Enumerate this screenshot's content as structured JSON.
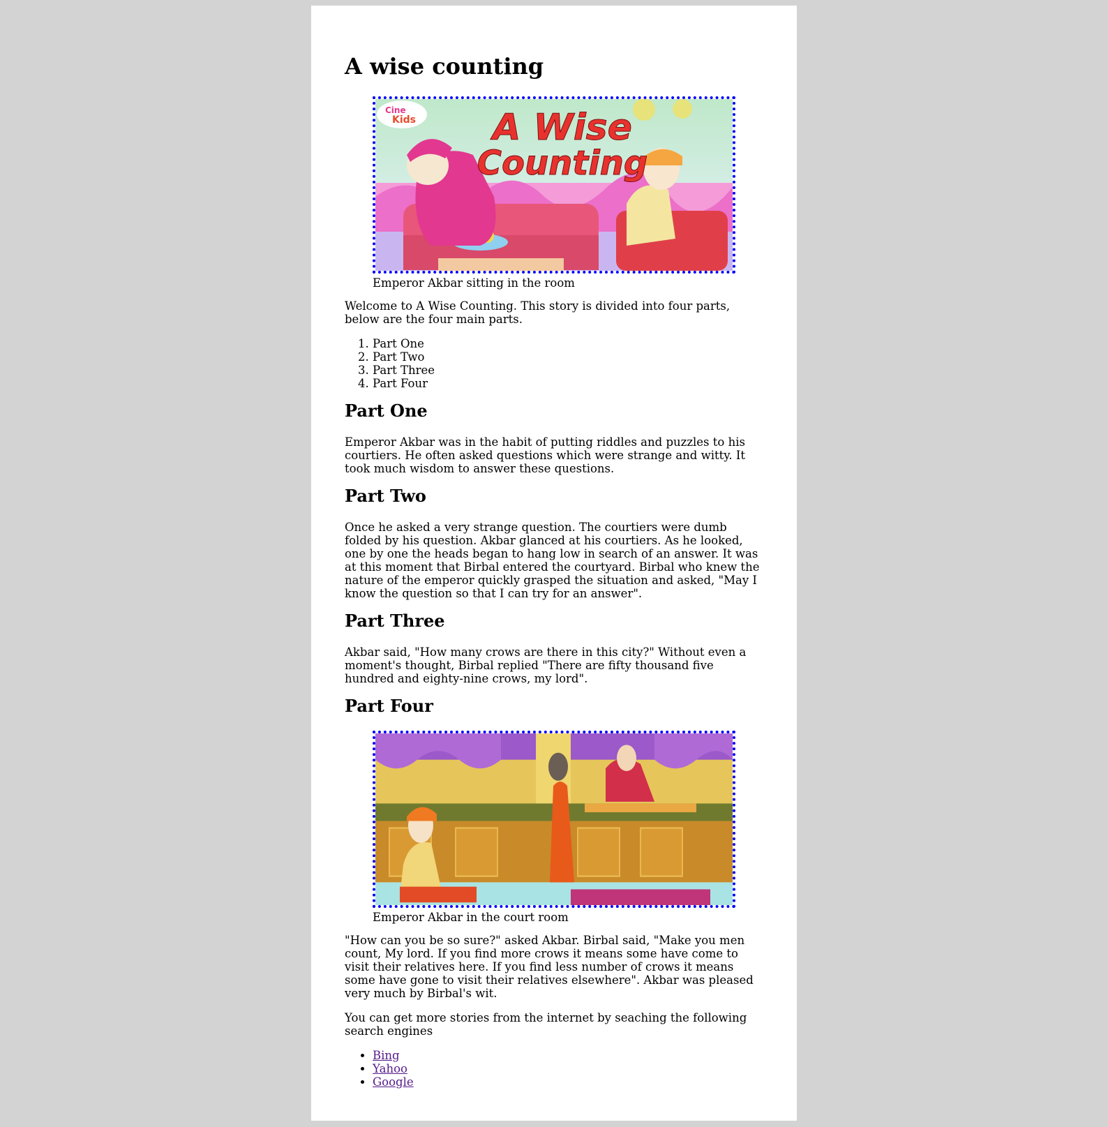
{
  "title": "A wise counting",
  "figure1": {
    "caption": "Emperor Akbar sitting in the room",
    "logo_text_1": "Cine",
    "logo_text_2": "Kids",
    "banner_line_1": "A Wise",
    "banner_line_2": "Counting"
  },
  "intro": "Welcome to A Wise Counting. This story is divided into four parts, below are the four main parts.",
  "parts_list": [
    "Part One",
    "Part Two",
    "Part Three",
    "Part Four"
  ],
  "sections": [
    {
      "heading": "Part One",
      "text": "Emperor Akbar was in the habit of putting riddles and puzzles to his courtiers. He often asked questions which were strange and witty. It took much wisdom to answer these questions."
    },
    {
      "heading": "Part Two",
      "text": "Once he asked a very strange question. The courtiers were dumb folded by his question. Akbar glanced at his courtiers. As he looked, one by one the heads began to hang low in search of an answer. It was at this moment that Birbal entered the courtyard. Birbal who knew the nature of the emperor quickly grasped the situation and asked, \"May I know the question so that I can try for an answer\"."
    },
    {
      "heading": "Part Three",
      "text": "Akbar said, \"How many crows are there in this city?\" Without even a moment's thought, Birbal replied \"There are fifty thousand five hundred and eighty-nine crows, my lord\"."
    },
    {
      "heading": "Part Four"
    }
  ],
  "figure2": {
    "caption": "Emperor Akbar in the court room"
  },
  "conclusion": "\"How can you be so sure?\" asked Akbar. Birbal said, \"Make you men count, My lord. If you find more crows it means some have come to visit their relatives here. If you find less number of crows it means some have gone to visit their relatives elsewhere\". Akbar was pleased very much by Birbal's wit.",
  "more_stories": "You can get more stories from the internet by seaching the following search engines",
  "links": [
    "Bing",
    "Yahoo",
    "Google"
  ]
}
